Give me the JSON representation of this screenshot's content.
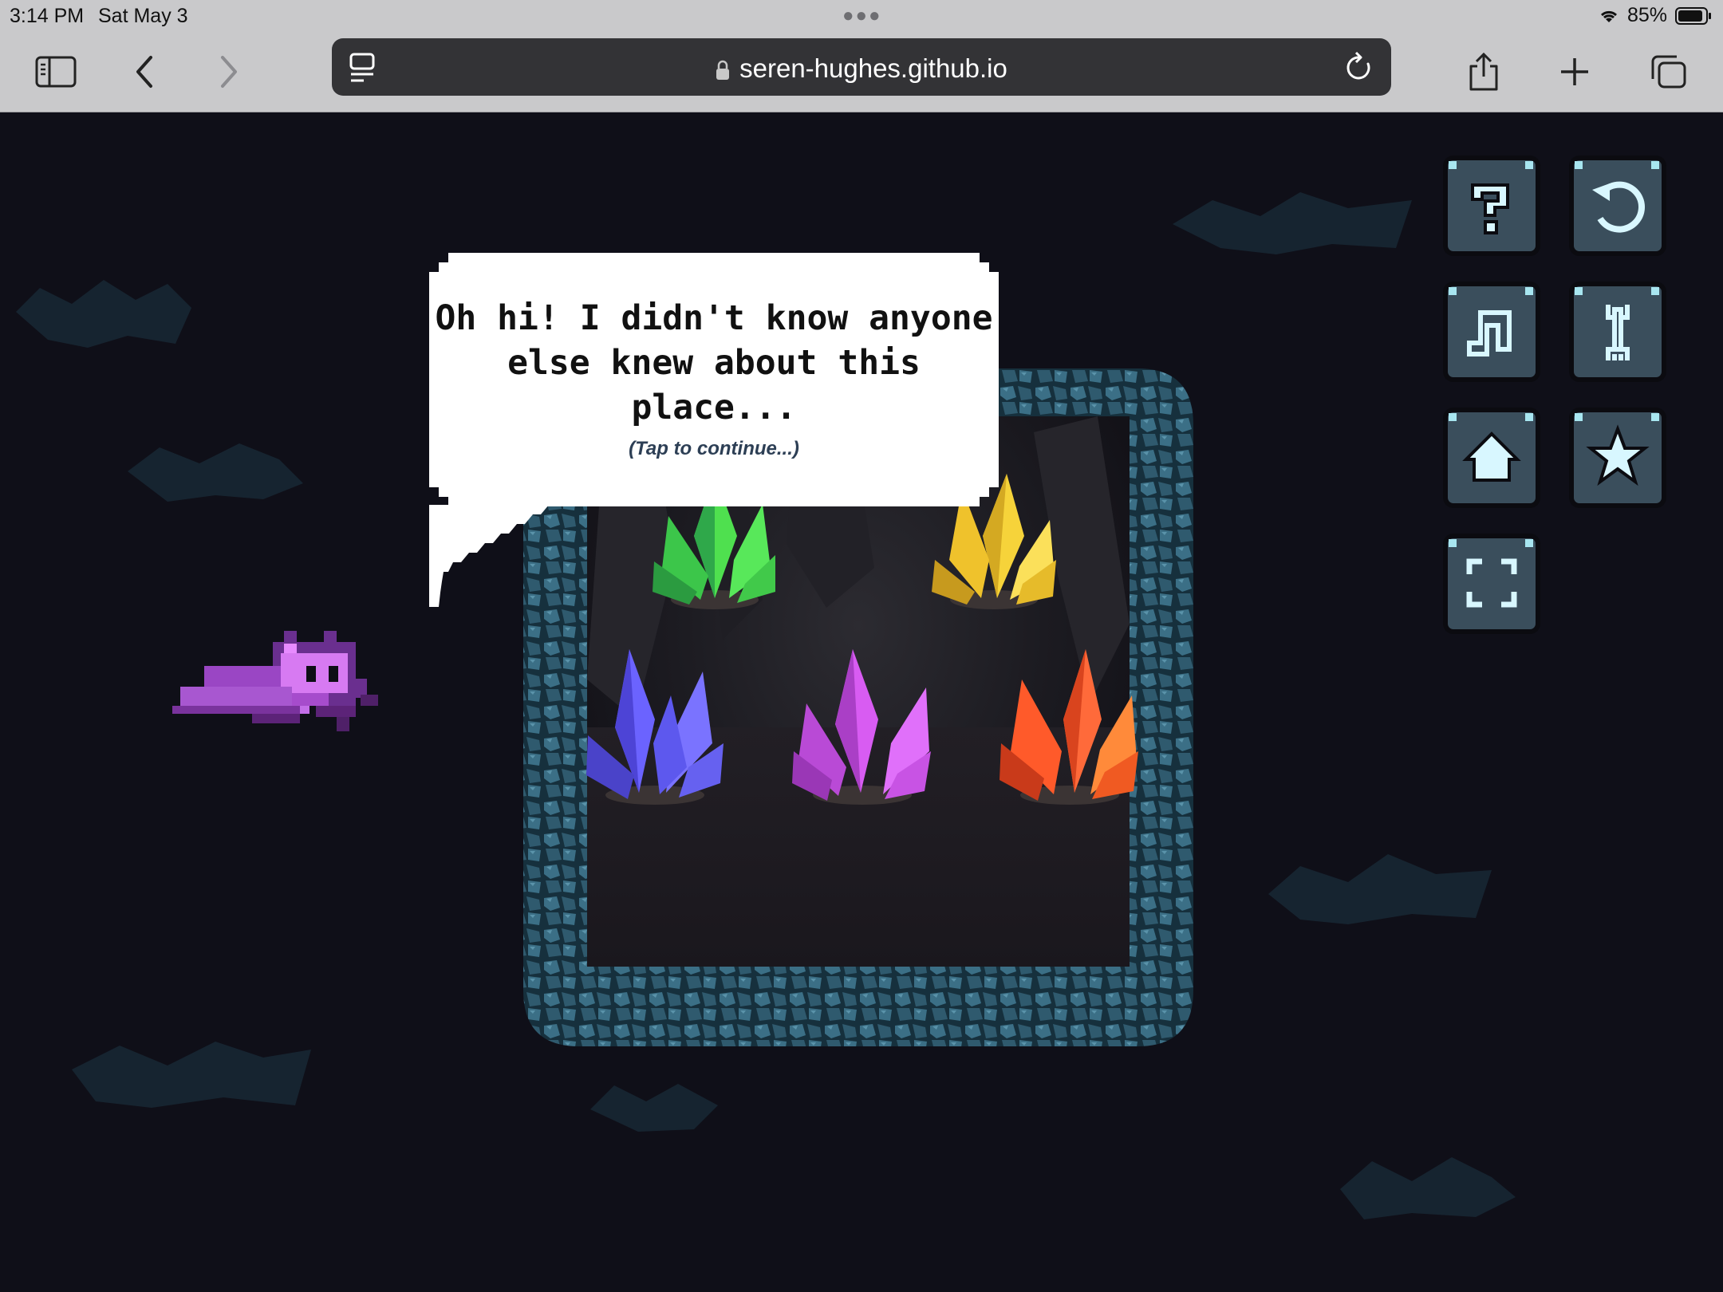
{
  "status_bar": {
    "time": "3:14 PM",
    "date": "Sat May 3",
    "battery": "85%"
  },
  "browser": {
    "url": "seren-hughes.github.io",
    "icons": [
      "sidebar-icon",
      "back-icon",
      "forward-icon",
      "tab-overview-icon",
      "lock-icon",
      "reload-icon",
      "share-icon",
      "plus-icon",
      "tabs-icon"
    ]
  },
  "dialog": {
    "line1": "Oh hi! I didn't know anyone",
    "line2": "else knew about this place...",
    "hint": "(Tap to continue...)"
  },
  "menu": [
    "help-icon",
    "restart-icon",
    "music-icon",
    "settings-wrench-icon",
    "home-icon",
    "star-icon",
    "fullscreen-icon"
  ],
  "crystals": [
    "green",
    "yellow",
    "blue",
    "purple",
    "orange"
  ],
  "colors": {
    "chrome_bg": "#c9c9cb",
    "game_bg": "#0f0f18",
    "rock": "#2f5a6e",
    "button": "#3a4e5c",
    "icon": "#a8e6f0"
  }
}
